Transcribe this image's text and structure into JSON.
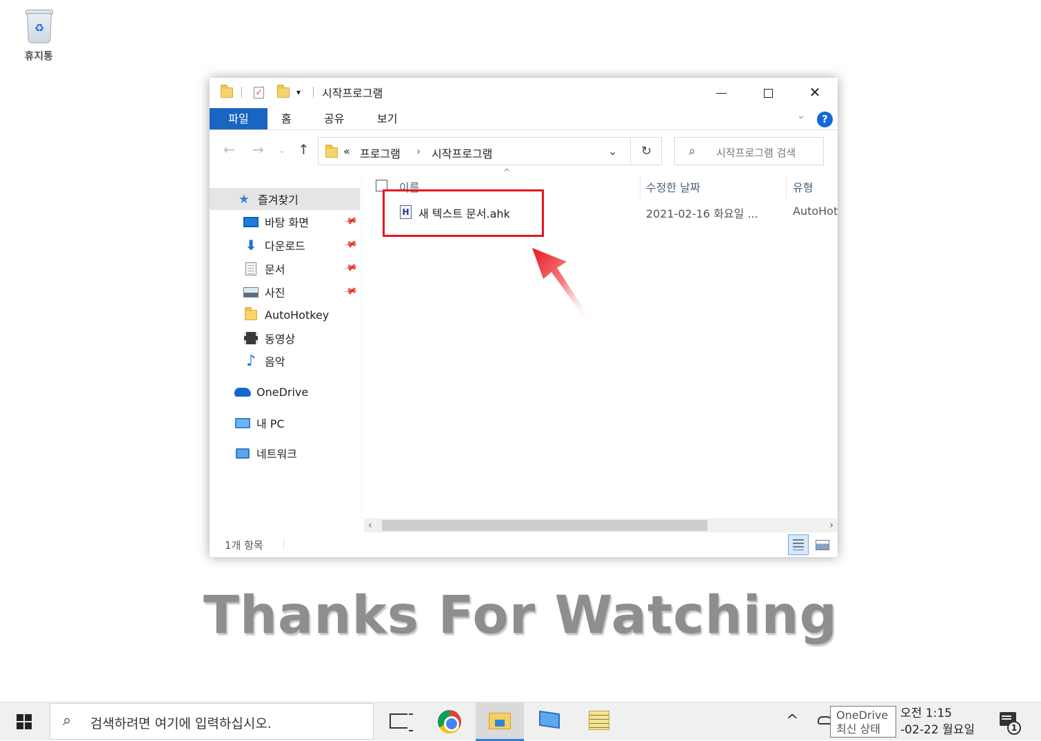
{
  "desktop": {
    "recycle_bin_label": "휴지통"
  },
  "window": {
    "title": "시작프로그램",
    "ribbon_tabs": {
      "file": "파일",
      "home": "홈",
      "share": "공유",
      "view": "보기"
    },
    "help_label": "?",
    "address": {
      "overflow": "«",
      "crumbs": [
        "프로그램",
        "시작프로그램"
      ],
      "separator": "›"
    },
    "search_placeholder": "시작프로그램 검색",
    "nav": {
      "quick_access": "즐겨찾기",
      "items": [
        {
          "label": "바탕 화면",
          "icon": "desktop-icon",
          "pinned": true
        },
        {
          "label": "다운로드",
          "icon": "download-icon",
          "pinned": true
        },
        {
          "label": "문서",
          "icon": "documents-icon",
          "pinned": true
        },
        {
          "label": "사진",
          "icon": "pictures-icon",
          "pinned": true
        },
        {
          "label": "AutoHotkey",
          "icon": "folder-icon",
          "pinned": false
        },
        {
          "label": "동영상",
          "icon": "videos-icon",
          "pinned": false
        },
        {
          "label": "음악",
          "icon": "music-icon",
          "pinned": false
        }
      ],
      "onedrive": "OneDrive",
      "this_pc": "내 PC",
      "network": "네트워크"
    },
    "columns": {
      "name": "이름",
      "modified": "수정한 날짜",
      "type": "유형"
    },
    "files": [
      {
        "name": "새 텍스트 문서.ahk",
        "modified": "2021-02-16 화요일 ...",
        "type": "AutoHotkey",
        "icon": "ahk-file-icon"
      }
    ],
    "status_text": "1개 항목"
  },
  "overlay": {
    "thanks_text": "Thanks For Watching",
    "highlight_color": "#e8141f"
  },
  "taskbar": {
    "search_placeholder": "검색하려면 여기에 입력하십시오.",
    "tooltip_line1": "OneDrive",
    "tooltip_line2": "최신 상태",
    "clock_time": "오전 1:15",
    "clock_date": "-02-22 월요일",
    "notification_count": "1"
  },
  "colors": {
    "accent": "#1a65c1",
    "taskbar_active": "#2d7fd8"
  }
}
